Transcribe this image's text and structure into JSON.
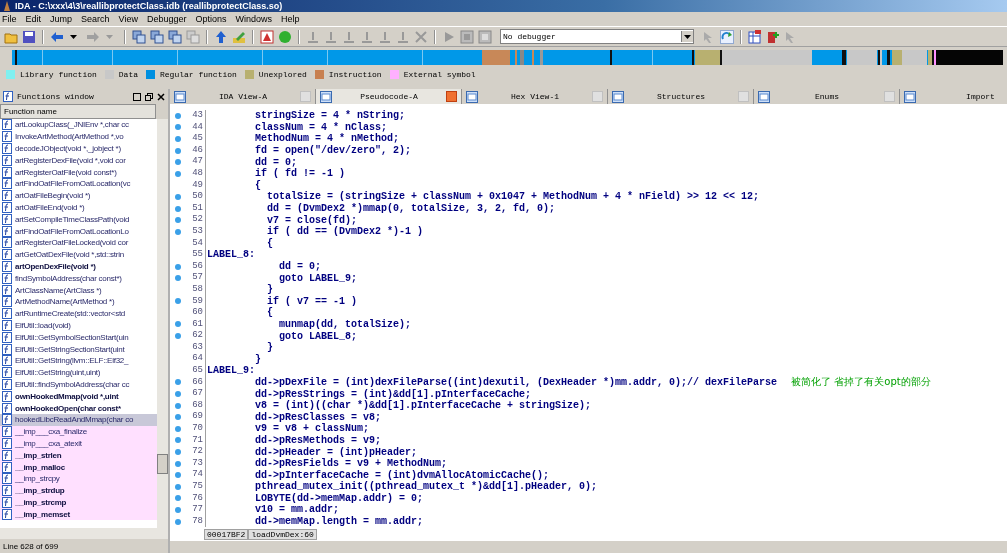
{
  "window": {
    "title": "IDA - C:\\xxx\\4\\3\\reallibprotectClass.idb (reallibprotectClass.so)"
  },
  "menu": [
    "File",
    "Edit",
    "Jump",
    "Search",
    "View",
    "Debugger",
    "Options",
    "Windows",
    "Help"
  ],
  "toolbar": {
    "debugger_select": "No debugger"
  },
  "legend": [
    {
      "label": "Library function",
      "color": "#80f0f0"
    },
    {
      "label": "Data",
      "color": "#c8c8c8"
    },
    {
      "label": "Regular function",
      "color": "#0090e0"
    },
    {
      "label": "Unexplored",
      "color": "#b8b070"
    },
    {
      "label": "Instruction",
      "color": "#c88050"
    },
    {
      "label": "External symbol",
      "color": "#ffb0ff"
    }
  ],
  "functions_window": {
    "title": "Functions window",
    "column": "Function name",
    "status": "Line 628 of 699",
    "items": [
      {
        "name": "artLookupClass(_JNIEnv *,char cc",
        "kind": "regular",
        "selected": false
      },
      {
        "name": "InvokeArtMethod(ArtMethod *,vo",
        "kind": "regular",
        "selected": false
      },
      {
        "name": "decodeJObject(void *,_jobject *)",
        "kind": "regular",
        "selected": false
      },
      {
        "name": "artRegisterDexFile(void *,void cor",
        "kind": "regular",
        "selected": false
      },
      {
        "name": "artRegisterOatFile(void const*)",
        "kind": "regular",
        "selected": false
      },
      {
        "name": "artFindOatFileFromOatLocation(vc",
        "kind": "regular",
        "selected": false
      },
      {
        "name": "artOatFileBegin(void *)",
        "kind": "regular",
        "selected": false
      },
      {
        "name": "artOatFileEnd(void *)",
        "kind": "regular",
        "selected": false
      },
      {
        "name": "artSetCompileTimeClassPath(void",
        "kind": "regular",
        "selected": false
      },
      {
        "name": "artFindOatFileFromOatLocationLo",
        "kind": "regular",
        "selected": false
      },
      {
        "name": "artRegisterOatFileLocked(void cor",
        "kind": "regular",
        "selected": false
      },
      {
        "name": "artGetOatDexFile(void *,std::strin",
        "kind": "regular",
        "selected": false
      },
      {
        "name": "artOpenDexFile(void *)",
        "kind": "bold",
        "selected": false
      },
      {
        "name": "findSymbolAddress(char const*)",
        "kind": "regular",
        "selected": false
      },
      {
        "name": "ArtClassName(ArtClass *)",
        "kind": "regular",
        "selected": false
      },
      {
        "name": "ArtMethodName(ArtMethod *)",
        "kind": "regular",
        "selected": false
      },
      {
        "name": "artRuntimeCreate(std::vector<std",
        "kind": "regular",
        "selected": false
      },
      {
        "name": "ElfUtil::load(void)",
        "kind": "regular",
        "selected": false
      },
      {
        "name": "ElfUtil::GetSymbolSectionStart(uin",
        "kind": "regular",
        "selected": false
      },
      {
        "name": "ElfUtil::GetStringSectionStart(uint",
        "kind": "regular",
        "selected": false
      },
      {
        "name": "ElfUtil::GetString(llvm::ELF::Elf32_",
        "kind": "regular",
        "selected": false
      },
      {
        "name": "ElfUtil::GetString(uint,uint)",
        "kind": "regular",
        "selected": false
      },
      {
        "name": "ElfUtil::findSymbolAddress(char cc",
        "kind": "regular",
        "selected": false
      },
      {
        "name": "ownHookedMmap(void *,uint",
        "kind": "bold",
        "selected": false
      },
      {
        "name": "ownHookedOpen(char const*",
        "kind": "bold",
        "selected": false
      },
      {
        "name": "hookedLibcReadAndMmap(char co",
        "kind": "regular",
        "selected": true
      },
      {
        "name": "__imp___cxa_finalize",
        "kind": "external",
        "selected": false
      },
      {
        "name": "__imp___cxa_atexit",
        "kind": "external",
        "selected": false
      },
      {
        "name": "__imp_strlen",
        "kind": "external-bold",
        "selected": false
      },
      {
        "name": "__imp_malloc",
        "kind": "external-bold",
        "selected": false
      },
      {
        "name": "__imp_strcpy",
        "kind": "external",
        "selected": false
      },
      {
        "name": "__imp_strdup",
        "kind": "external-bold",
        "selected": false
      },
      {
        "name": "__imp_strcmp",
        "kind": "external-bold",
        "selected": false
      },
      {
        "name": "__imp_memset",
        "kind": "external-bold",
        "selected": false
      }
    ]
  },
  "tabs": [
    {
      "label": "IDA View-A",
      "selected": false
    },
    {
      "label": "Pseudocode-A",
      "selected": true
    },
    {
      "label": "Hex View-1",
      "selected": false
    },
    {
      "label": "Structures",
      "selected": false
    },
    {
      "label": "Enums",
      "selected": false
    },
    {
      "label": "Import",
      "selected": false
    }
  ],
  "code": {
    "lines": [
      {
        "num": "43",
        "dot": true,
        "text": "        stringSize = 4 * nString;"
      },
      {
        "num": "44",
        "dot": true,
        "text": "        classNum = 4 * nClass;"
      },
      {
        "num": "45",
        "dot": true,
        "text": "        MethodNum = 4 * nMethod;"
      },
      {
        "num": "46",
        "dot": true,
        "text": "        fd = open(\"/dev/zero\", 2);"
      },
      {
        "num": "47",
        "dot": true,
        "text": "        dd = 0;"
      },
      {
        "num": "48",
        "dot": true,
        "text": "        if ( fd != -1 )"
      },
      {
        "num": "49",
        "dot": false,
        "text": "        {"
      },
      {
        "num": "50",
        "dot": true,
        "text": "          totalSize = (stringSize + classNum + 0x1047 + MethodNum + 4 * nField) >> 12 << 12;"
      },
      {
        "num": "51",
        "dot": true,
        "text": "          dd = (DvmDex2 *)mmap(0, totalSize, 3, 2, fd, 0);"
      },
      {
        "num": "52",
        "dot": true,
        "text": "          v7 = close(fd);"
      },
      {
        "num": "53",
        "dot": true,
        "text": "          if ( dd == (DvmDex2 *)-1 )"
      },
      {
        "num": "54",
        "dot": false,
        "text": "          {"
      },
      {
        "num": "55",
        "dot": false,
        "text": "LABEL_8:"
      },
      {
        "num": "56",
        "dot": true,
        "text": "            dd = 0;"
      },
      {
        "num": "57",
        "dot": true,
        "text": "            goto LABEL_9;"
      },
      {
        "num": "58",
        "dot": false,
        "text": "          }"
      },
      {
        "num": "59",
        "dot": true,
        "text": "          if ( v7 == -1 )"
      },
      {
        "num": "60",
        "dot": false,
        "text": "          {"
      },
      {
        "num": "61",
        "dot": true,
        "text": "            munmap(dd, totalSize);"
      },
      {
        "num": "62",
        "dot": true,
        "text": "            goto LABEL_8;"
      },
      {
        "num": "63",
        "dot": false,
        "text": "          }"
      },
      {
        "num": "64",
        "dot": false,
        "text": "        }"
      },
      {
        "num": "65",
        "dot": false,
        "text": "LABEL_9:"
      },
      {
        "num": "66",
        "dot": true,
        "text": "        dd->pDexFile = (int)dexFileParse((int)dexutil, (DexHeader *)mm.addr, 0);// dexFileParse",
        "comment": "被简化了 省掉了有关opt的部分"
      },
      {
        "num": "67",
        "dot": true,
        "text": "        dd->pResStrings = (int)&dd[1].pInterfaceCache;"
      },
      {
        "num": "68",
        "dot": true,
        "text": "        v8 = (int)((char *)&dd[1].pInterfaceCache + stringSize);"
      },
      {
        "num": "69",
        "dot": true,
        "text": "        dd->pResClasses = v8;"
      },
      {
        "num": "70",
        "dot": true,
        "text": "        v9 = v8 + classNum;"
      },
      {
        "num": "71",
        "dot": true,
        "text": "        dd->pResMethods = v9;"
      },
      {
        "num": "72",
        "dot": true,
        "text": "        dd->pHeader = (int)pHeader;"
      },
      {
        "num": "73",
        "dot": true,
        "text": "        dd->pResFields = v9 + MethodNum;"
      },
      {
        "num": "74",
        "dot": true,
        "text": "        dd->pInterfaceCache = (int)dvmAllocAtomicCache();"
      },
      {
        "num": "75",
        "dot": true,
        "text": "        pthread_mutex_init((pthread_mutex_t *)&dd[1].pHeader, 0);"
      },
      {
        "num": "76",
        "dot": true,
        "text": "        LOBYTE(dd->memMap.addr) = 0;"
      },
      {
        "num": "77",
        "dot": true,
        "text": "        v10 = mm.addr;"
      },
      {
        "num": "78",
        "dot": true,
        "text": "        dd->memMap.length = mm.addr;"
      }
    ],
    "address": "00017BF2",
    "location": "loadDvmDex:60"
  }
}
